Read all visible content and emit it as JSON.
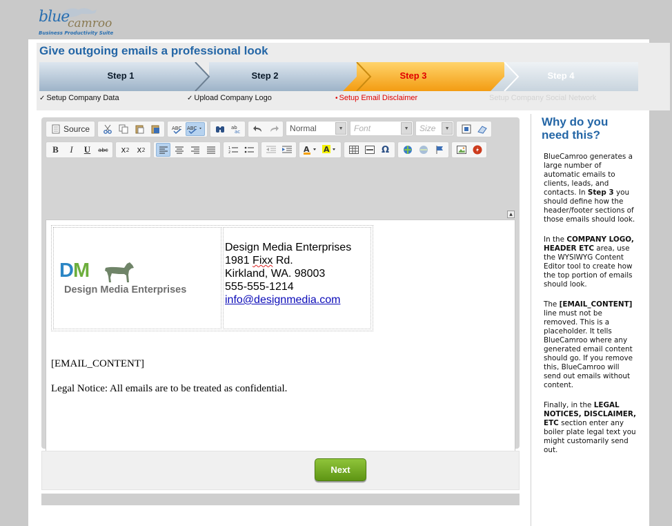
{
  "brand": {
    "name_part1": "blue",
    "name_part2": "camroo",
    "tagline": "Business Productivity Suite"
  },
  "wizard": {
    "title": "Give outgoing emails a professional look",
    "steps": [
      {
        "label": "Step 1",
        "subtitle": "Setup Company Data",
        "status": "done",
        "marker": "✓"
      },
      {
        "label": "Step 2",
        "subtitle": "Upload Company Logo",
        "status": "done",
        "marker": "✓"
      },
      {
        "label": "Step 3",
        "subtitle": "Setup Email Disclaimer",
        "status": "current",
        "marker": "•"
      },
      {
        "label": "Step 4",
        "subtitle": "Setup Company Social Network",
        "status": "pending",
        "marker": ""
      }
    ],
    "colors": {
      "done": "#0b1a2a",
      "current": "#e00000",
      "pending": "#dcdcdc",
      "accent": "#f6a623"
    }
  },
  "toolbar": {
    "source_label": "Source",
    "format_value": "Normal",
    "font_placeholder": "Font",
    "size_placeholder": "Size"
  },
  "editor": {
    "company": "Design Media Enterprises",
    "street_num": "1981",
    "street_name": "Fixx",
    "street_suffix": "Rd.",
    "city_line": "Kirkland, WA. 98003",
    "phone": "555-555-1214",
    "email": "info@designmedia.com",
    "logo_initial_d": "D",
    "logo_initial_m": "M",
    "logo_text": "Design Media Enterprises",
    "placeholder": "[EMAIL_CONTENT]",
    "legal": "Legal Notice: All emails are to be treated as confidential."
  },
  "actions": {
    "next_label": "Next"
  },
  "info": {
    "heading": "Why do you need this?",
    "p1a": "BlueCamroo generates a large number of automatic emails to clients, leads, and contacts. In ",
    "p1b": "Step 3",
    "p1c": " you should define how the header/footer sections of those emails should look.",
    "p2a": "In the ",
    "p2b": "COMPANY LOGO, HEADER ETC",
    "p2c": " area, use the WYSIWYG Content Editor tool to create how the top portion of emails should look.",
    "p3a": "The ",
    "p3b": "[EMAIL_CONTENT]",
    "p3c": " line must not be removed. This is a placeholder. It tells BlueCamroo where any generated email content should go. If you remove this, BlueCamroo will send out emails without content.",
    "p4a": "Finally, in the ",
    "p4b": "LEGAL NOTICES, DISCLAIMER, ETC",
    "p4c": " section enter any boiler plate legal text you might customarily send out."
  }
}
